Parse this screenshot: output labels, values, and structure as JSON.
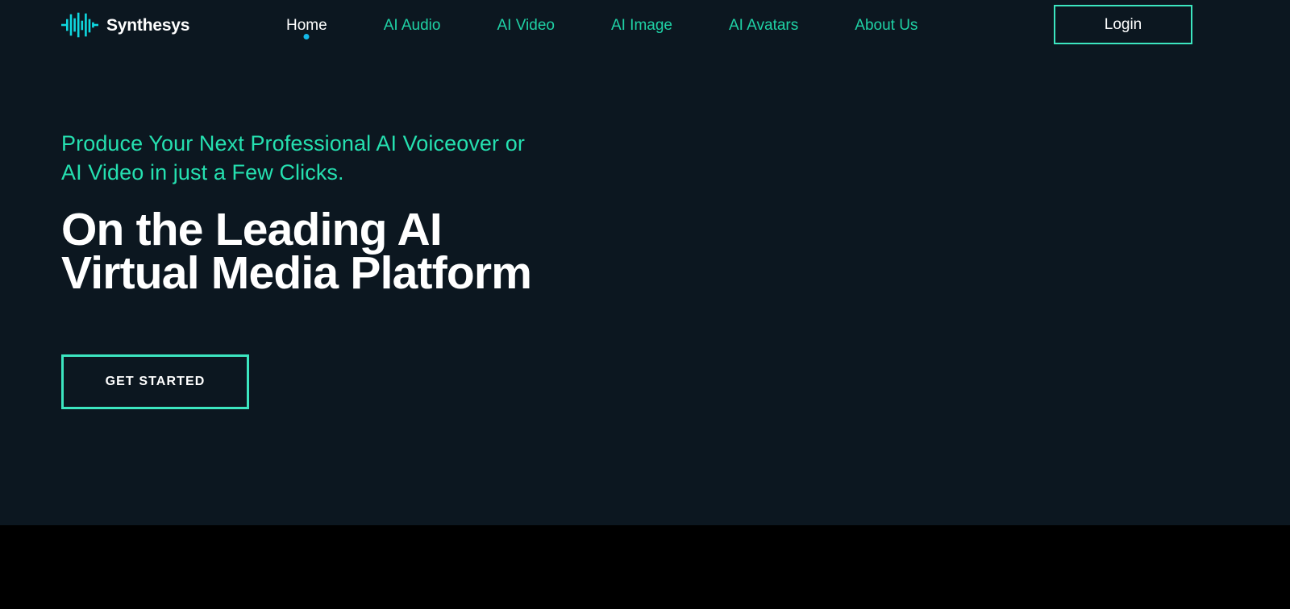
{
  "theme": {
    "page_background": "#0c1720",
    "below_fold_background": "#000000",
    "accent_teal": "#1fd1a5",
    "accent_border": "#3ce6c0",
    "subtitle_teal": "#25e0b0",
    "active_dot": "#14b8e8",
    "text_white": "#ffffff"
  },
  "header": {
    "brand": {
      "name": "Synthesys",
      "logo_icon": "audio-waveform-icon"
    },
    "nav": [
      {
        "label": "Home",
        "active": true
      },
      {
        "label": "AI Audio",
        "active": false
      },
      {
        "label": "AI Video",
        "active": false
      },
      {
        "label": "AI Image",
        "active": false
      },
      {
        "label": "AI Avatars",
        "active": false
      },
      {
        "label": "About Us",
        "active": false
      }
    ],
    "login_label": "Login"
  },
  "hero": {
    "subtitle_line1": "Produce Your Next Professional AI Voiceover or",
    "subtitle_line2": "AI Video in just a Few Clicks.",
    "title_line1": "On the Leading AI",
    "title_line2": "Virtual Media Platform",
    "cta_label": "GET STARTED"
  }
}
